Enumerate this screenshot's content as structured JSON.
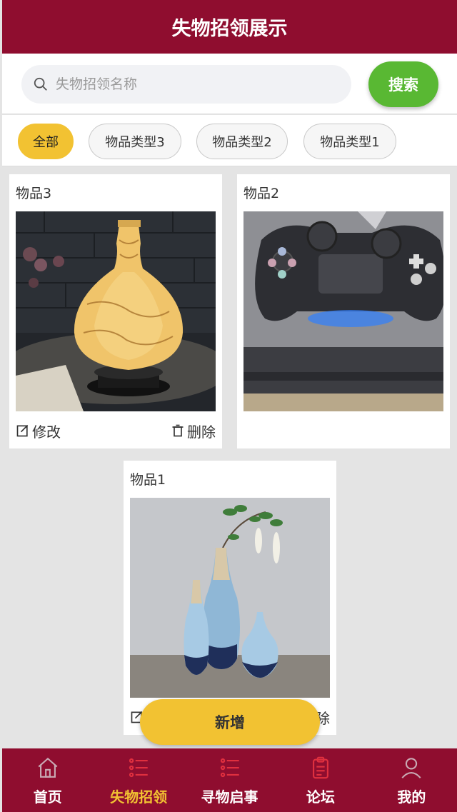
{
  "header": {
    "title": "失物招领展示"
  },
  "search": {
    "placeholder": "失物招领名称",
    "value": "",
    "button_label": "搜索"
  },
  "filters": [
    {
      "label": "全部",
      "active": true
    },
    {
      "label": "物品类型3",
      "active": false
    },
    {
      "label": "物品类型2",
      "active": false
    },
    {
      "label": "物品类型1",
      "active": false
    }
  ],
  "items": [
    {
      "title": "物品3",
      "image": "porcelain-vase-lamp",
      "edit_label": "修改",
      "delete_label": "删除"
    },
    {
      "title": "物品2",
      "image": "game-controller"
    },
    {
      "title": "物品1",
      "image": "blue-ceramic-vases",
      "edit_label": "修改",
      "delete_label": "删除"
    }
  ],
  "add_button": {
    "label": "新增"
  },
  "tabbar": {
    "items": [
      {
        "label": "首页",
        "icon": "home-icon",
        "active": false
      },
      {
        "label": "失物招领",
        "icon": "list-icon",
        "active": true
      },
      {
        "label": "寻物启事",
        "icon": "list-icon",
        "active": false
      },
      {
        "label": "论坛",
        "icon": "clipboard-icon",
        "active": false
      },
      {
        "label": "我的",
        "icon": "user-icon",
        "active": false
      }
    ]
  },
  "colors": {
    "primary": "#8f0d2f",
    "accent": "#f2c232",
    "search_button": "#59b833",
    "active_tab": "#f2c232"
  }
}
